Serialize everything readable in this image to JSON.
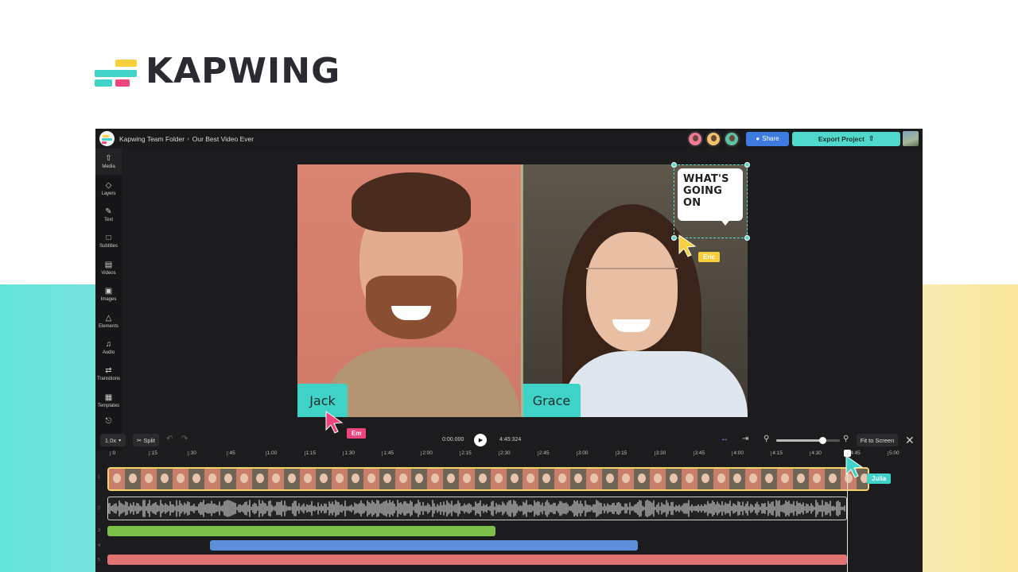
{
  "brand": {
    "name": "KAPWING"
  },
  "topbar": {
    "folder": "Kapwing Team Folder",
    "separator": "›",
    "project": "Our Best Video Ever",
    "share_label": "Share",
    "export_label": "Export Project",
    "collaborators": [
      "collaborator-1",
      "collaborator-2",
      "collaborator-3"
    ]
  },
  "sidebar": {
    "items": [
      {
        "label": "Media",
        "icon": "upload-icon"
      },
      {
        "label": "Layers",
        "icon": "layers-icon"
      },
      {
        "label": "Text",
        "icon": "text-icon"
      },
      {
        "label": "Subtitles",
        "icon": "subtitles-icon"
      },
      {
        "label": "Videos",
        "icon": "film-icon"
      },
      {
        "label": "Images",
        "icon": "image-icon"
      },
      {
        "label": "Elements",
        "icon": "shapes-icon"
      },
      {
        "label": "Audio",
        "icon": "music-icon"
      },
      {
        "label": "Transitions",
        "icon": "transition-icon"
      },
      {
        "label": "Templates",
        "icon": "grid-icon"
      },
      {
        "label": "",
        "icon": "plug-icon"
      }
    ]
  },
  "canvas": {
    "left_name": "Jack",
    "right_name": "Grace",
    "bubble_lines": [
      "WHAT'S",
      "GOING",
      "ON"
    ],
    "cursors": [
      {
        "name": "Em",
        "color": "#f0447c"
      },
      {
        "name": "Eric",
        "color": "#f7cf3c"
      },
      {
        "name": "Julia",
        "color": "#3fd2c7"
      }
    ]
  },
  "controls": {
    "speed": "1.0x",
    "split": "Split",
    "current_time": "0:00.000",
    "duration": "4:45:324",
    "fit_label": "Fit to Screen",
    "zoom_level": 0.72
  },
  "ruler": {
    "ticks": [
      ":0",
      ":15",
      ":30",
      ":45",
      "1:00",
      "1:15",
      "1:30",
      "1:45",
      "2:00",
      "2:15",
      "2:30",
      "2:45",
      "3:00",
      "3:15",
      "3:30",
      "3:45",
      "4:00",
      "4:15",
      "4:30",
      "4:45",
      "5:00"
    ]
  },
  "colors": {
    "accent": "#3fd2c7",
    "share": "#3d7be0",
    "clip_green": "#7cbf4a",
    "clip_blue": "#5b8fd9",
    "clip_red": "#e07272",
    "video_border": "#f6d36b"
  }
}
